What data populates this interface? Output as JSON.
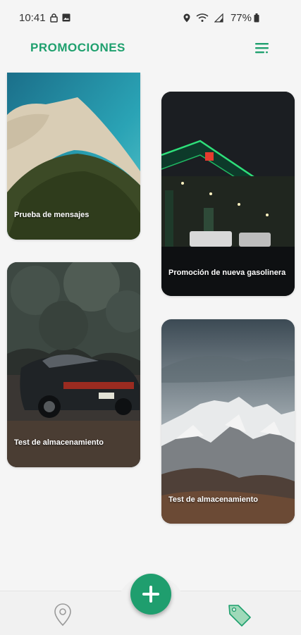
{
  "status_bar": {
    "time": "10:41",
    "battery": "77%",
    "icons": [
      "lock-icon",
      "image-icon",
      "location-icon",
      "wifi-icon",
      "signal-icon",
      "battery-icon"
    ]
  },
  "header": {
    "title": "PROMOCIONES",
    "menu_icon": "filter-menu-icon"
  },
  "cards": [
    {
      "label": "Prueba de mensajes",
      "image": "beach-aerial"
    },
    {
      "label": "Promoción de nueva gasolinera",
      "image": "gas-station-night"
    },
    {
      "label": "Test de almacenamiento",
      "image": "sports-car-forest"
    },
    {
      "label": "Test de almacenamiento",
      "image": "snowy-mountains"
    }
  ],
  "bottom_nav": {
    "items": [
      "location-pin-icon",
      "tag-icon"
    ],
    "fab_icon": "plus-icon"
  },
  "colors": {
    "accent": "#1fa06e",
    "background": "#f5f5f5"
  }
}
